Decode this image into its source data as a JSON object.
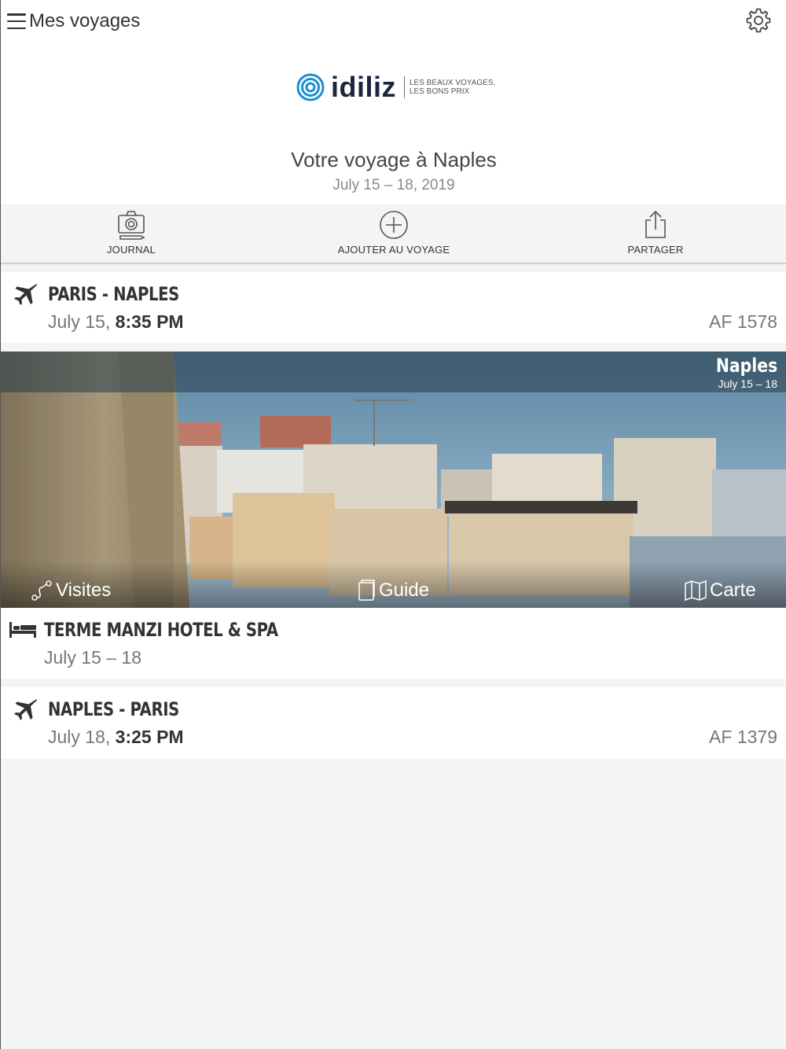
{
  "nav": {
    "title": "Mes voyages"
  },
  "brand": {
    "name": "idiliz",
    "tagline_1": "LES BEAUX VOYAGES,",
    "tagline_2": "LES BONS PRIX"
  },
  "trip": {
    "title": "Votre voyage à Naples",
    "dates": "July 15 – 18, 2019"
  },
  "toolbar": [
    {
      "label": "JOURNAL",
      "icon": "camera-icon"
    },
    {
      "label": "AJOUTER AU VOYAGE",
      "icon": "plus-circle-icon"
    },
    {
      "label": "PARTAGER",
      "icon": "share-icon"
    }
  ],
  "items": {
    "flight_out": {
      "icon": "airplane-icon",
      "title": "PARIS - NAPLES",
      "date": "July 15,",
      "time": "8:35 PM",
      "code": "AF 1578"
    },
    "destination": {
      "city": "Naples",
      "dates": "July 15 – 18",
      "links": [
        {
          "label": "Visites",
          "icon": "route-icon"
        },
        {
          "label": "Guide",
          "icon": "book-icon"
        },
        {
          "label": "Carte",
          "icon": "map-icon"
        }
      ]
    },
    "hotel": {
      "icon": "bed-icon",
      "title": "TERME MANZI HOTEL & SPA",
      "dates": "July 15 – 18"
    },
    "flight_back": {
      "icon": "airplane-icon",
      "title": "NAPLES - PARIS",
      "date": "July 18,",
      "time": "3:25 PM",
      "code": "AF 1379"
    }
  },
  "colors": {
    "brand_blue": "#1a8fd1",
    "brand_dark": "#1b2540",
    "background": "#f4f4f4",
    "text": "#333333",
    "muted": "#777777"
  }
}
